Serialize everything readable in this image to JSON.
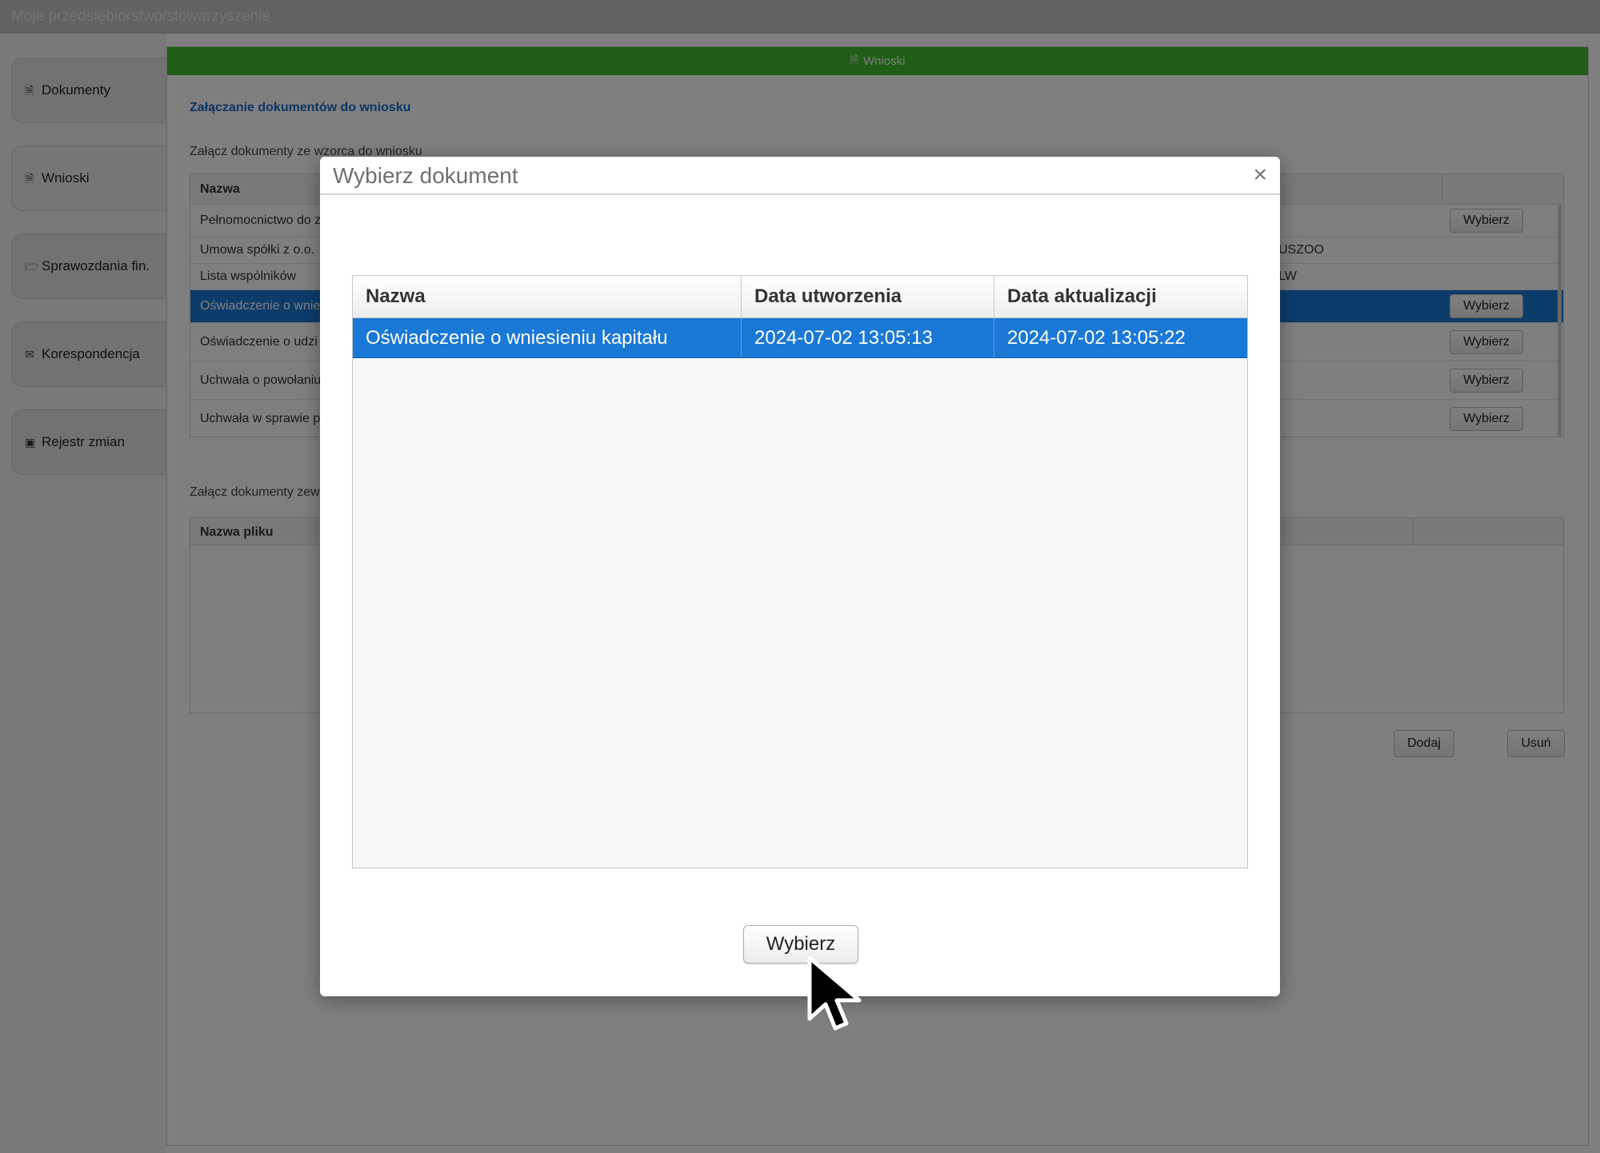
{
  "app": {
    "title": "Moje przedsiębiorstwo/stowarzyszenie"
  },
  "sidebar": {
    "items": [
      {
        "label": "Dokumenty",
        "icon": "document-icon"
      },
      {
        "label": "Wnioski",
        "icon": "application-icon"
      },
      {
        "label": "Sprawozdania fin.",
        "icon": "folder-open-icon"
      },
      {
        "label": "Korespondencja",
        "icon": "envelope-icon"
      },
      {
        "label": "Rejestr zmian",
        "icon": "briefcase-icon"
      }
    ]
  },
  "content": {
    "header": "Wnioski",
    "section_title": "Załączanie dokumentów do wniosku",
    "template_docs_label": "Załącz dokumenty ze wzorca do wniosku",
    "template_table": {
      "column": "Nazwa",
      "rows": [
        {
          "name": "Pełnomocnictwo do z",
          "extra": "",
          "button": "Wybierz"
        },
        {
          "name": "Umowa spółki z o.o.",
          "extra": "USZOO",
          "button": ""
        },
        {
          "name": "Lista wspólników",
          "extra": "LW",
          "button": ""
        },
        {
          "name": "Oświadczenie o wnie",
          "extra": "",
          "button": "Wybierz",
          "selected": true
        },
        {
          "name": "Oświadczenie o udzi",
          "extra": "",
          "button": "Wybierz"
        },
        {
          "name": "Uchwała o powołaniu",
          "extra": "",
          "button": "Wybierz"
        },
        {
          "name": "Uchwała w sprawie p",
          "extra": "",
          "button": "Wybierz"
        }
      ]
    },
    "external_docs_label": "Załącz dokumenty zew",
    "files_table": {
      "column": "Nazwa pliku"
    },
    "add_button": "Dodaj",
    "remove_button": "Usuń"
  },
  "modal": {
    "title": "Wybierz dokument",
    "close_symbol": "×",
    "columns": [
      "Nazwa",
      "Data utworzenia",
      "Data aktualizacji"
    ],
    "rows": [
      {
        "name": "Oświadczenie o wniesieniu kapitału",
        "created": "2024-07-02 13:05:13",
        "updated": "2024-07-02 13:05:22",
        "selected": true
      }
    ],
    "select_button": "Wybierz"
  },
  "colors": {
    "header_green": "#3fbc2c",
    "selection_blue": "#1a78d6",
    "link_blue": "#1a6bcc"
  }
}
